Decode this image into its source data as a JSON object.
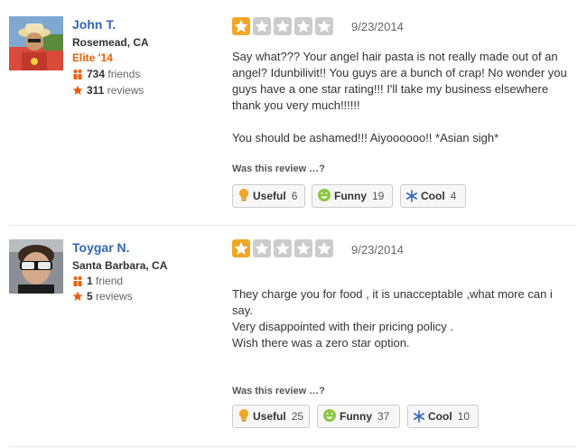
{
  "reviews": [
    {
      "user": {
        "name": "John T.",
        "location": "Rosemead, CA",
        "elite": "Elite '14",
        "friends_count": "734",
        "friends_label": "friends",
        "reviews_count": "311",
        "reviews_label": "reviews"
      },
      "rating": 1,
      "max_rating": 5,
      "date": "9/23/2014",
      "paragraphs": [
        "Say what??? Your angel hair pasta is not really made out of an angel? Idunbilivit!! You guys are a bunch of crap! No wonder you guys have a one star rating!!! I'll take my business elsewhere thank you very much!!!!!!",
        "You should be ashamed!!! Aiyoooooo!! *Asian sigh*"
      ],
      "feedback_prompt": "Was this review …?",
      "votes": [
        {
          "label": "Useful",
          "count": "6",
          "icon": "lightbulb-icon"
        },
        {
          "label": "Funny",
          "count": "19",
          "icon": "smiley-icon"
        },
        {
          "label": "Cool",
          "count": "4",
          "icon": "snowflake-icon"
        }
      ]
    },
    {
      "user": {
        "name": "Toygar N.",
        "location": "Santa Barbara, CA",
        "friends_count": "1",
        "friends_label": "friend",
        "reviews_count": "5",
        "reviews_label": "reviews"
      },
      "rating": 1,
      "max_rating": 5,
      "date": "9/23/2014",
      "paragraphs": [
        "They charge you for food , it is unacceptable ,what more can i say.\nVery disappointed with their pricing policy .\nWish there was a zero star option."
      ],
      "feedback_prompt": "Was this review …?",
      "votes": [
        {
          "label": "Useful",
          "count": "25",
          "icon": "lightbulb-icon"
        },
        {
          "label": "Funny",
          "count": "37",
          "icon": "smiley-icon"
        },
        {
          "label": "Cool",
          "count": "10",
          "icon": "snowflake-icon"
        }
      ]
    }
  ],
  "colors": {
    "name": "#3366bb",
    "elite": "#f15c00",
    "star_on": "#f0a728",
    "star_off": "#cccccc",
    "stat_icon": "#f15c00"
  }
}
